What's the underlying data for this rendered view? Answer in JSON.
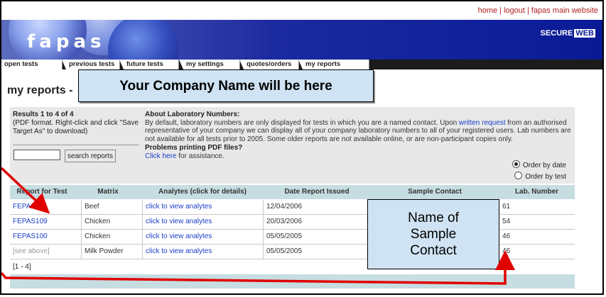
{
  "toplinks": {
    "home": "home",
    "logout": "logout",
    "main": "fapas main website",
    "sep": "|"
  },
  "banner": {
    "logo": "fapas",
    "secure": "SECURE",
    "web": "WEB"
  },
  "tabs": [
    "open tests",
    "previous tests",
    "future tests",
    "my settings",
    "quotes/orders",
    "my reports"
  ],
  "page_title": "my reports -",
  "callouts": {
    "company": "Your Company Name will be here",
    "contact": [
      "Name of",
      "Sample",
      "Contact"
    ]
  },
  "results": {
    "header": "Results 1 to 4 of 4",
    "note": "(PDF format. Right-click and click \"Save Target As\" to download)",
    "search_placeholder": "",
    "search_button": "search reports"
  },
  "about": {
    "header": "About Laboratory Numbers:",
    "text1": "By default, laboratory numbers are only displayed for tests in which you are a named contact. Upon ",
    "written_request": "written request",
    "text2": " from an authorised representative of your company we can display all of your company laboratory numbers to all of your registered users. Lab numbers are not available for all tests prior to 2005. Some older reports are not available online, or are non-participant copies only.",
    "pdf_header": "Problems printing PDF files?",
    "click_here": "Click here",
    "assist": " for assistance."
  },
  "order": {
    "by_date": "Order by date",
    "by_test": "Order by test",
    "selected": "date"
  },
  "table": {
    "columns": [
      "Report for Test",
      "Matrix",
      "Analytes (click for details)",
      "Date Report Issued",
      "Sample Contact",
      "Lab. Number"
    ],
    "rows": [
      {
        "report": "FEPAS110",
        "matrix": "Beef",
        "analytes": "click to view analytes",
        "date": "12/04/2006",
        "contact": "",
        "lab": "61"
      },
      {
        "report": "FEPAS109",
        "matrix": "Chicken",
        "analytes": "click to view analytes",
        "date": "20/03/2006",
        "contact": "",
        "lab": "54"
      },
      {
        "report": "FEPAS100",
        "matrix": "Chicken",
        "analytes": "click to view analytes",
        "date": "05/05/2005",
        "contact": "",
        "lab": "46"
      },
      {
        "report": "[see above]",
        "matrix": "Milk Powder",
        "analytes": "click to view analytes",
        "date": "05/05/2005",
        "contact": "",
        "lab": "46"
      }
    ],
    "pager": "[1 - 4]"
  },
  "colors": {
    "banner": "#0a1a96",
    "header_row": "#c6dde2",
    "panel": "#e8e8e8",
    "link": "#1a3ec9",
    "arrow": "#e00000",
    "callout": "#cfe3f4"
  }
}
